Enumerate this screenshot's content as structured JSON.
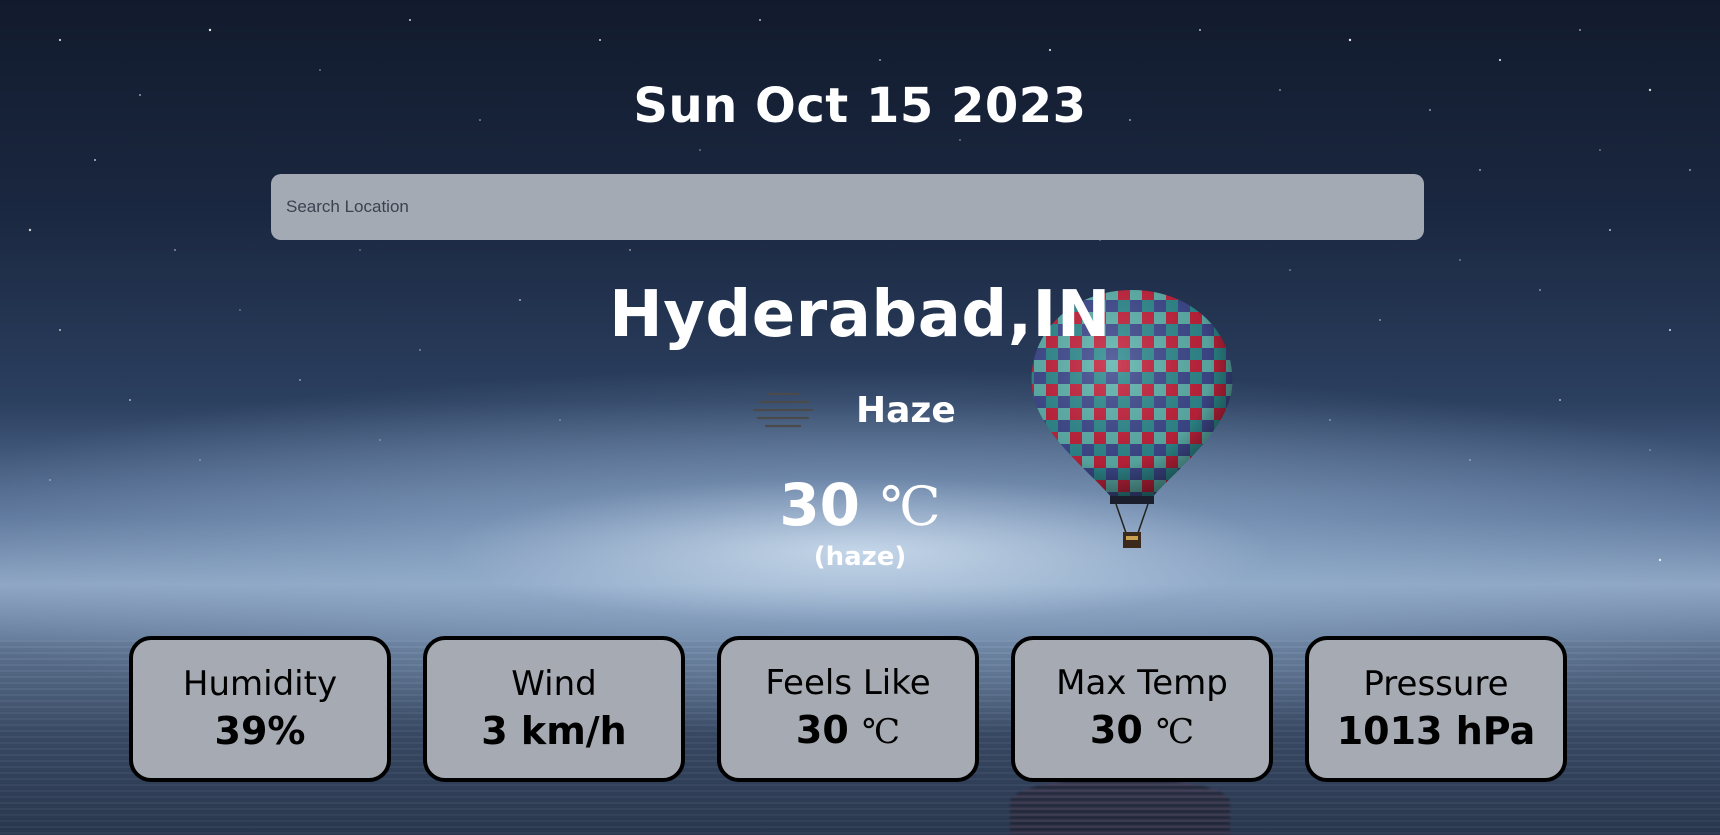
{
  "header": {
    "date": "Sun Oct 15 2023"
  },
  "search": {
    "placeholder": "Search Location",
    "value": ""
  },
  "weather": {
    "location": "Hyderabad,IN",
    "condition_icon": "haze-icon",
    "condition": "Haze",
    "temperature": "30",
    "temperature_unit": "℃",
    "description": "(haze)"
  },
  "stats": [
    {
      "label": "Humidity",
      "value": "39%",
      "unit": ""
    },
    {
      "label": "Wind",
      "value": "3 km/h",
      "unit": ""
    },
    {
      "label": "Feels Like",
      "value": "30",
      "unit": "℃"
    },
    {
      "label": "Max Temp",
      "value": "30",
      "unit": "℃"
    },
    {
      "label": "Pressure",
      "value": "1013 hPa",
      "unit": ""
    }
  ],
  "colors": {
    "text_primary": "#ffffff",
    "card_background": "#a6aab2",
    "card_border": "#000000",
    "search_background": "#a3aab3"
  }
}
